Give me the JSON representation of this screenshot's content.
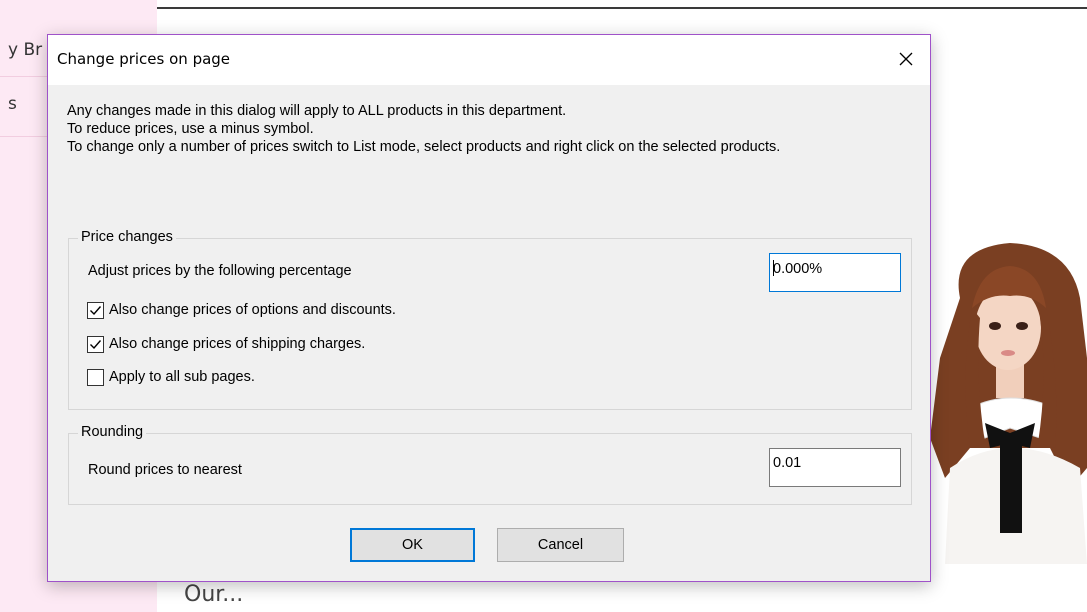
{
  "background": {
    "sidebar_items": [
      "y Br",
      "s"
    ],
    "footer_text": "Our..."
  },
  "dialog": {
    "title": "Change prices on page",
    "close_icon": "close-icon",
    "intro_lines": [
      "Any changes made in this dialog will apply to ALL products in this department.",
      "To reduce prices, use a minus symbol.",
      "To change only a number of prices switch to List mode, select products and right click on the selected products."
    ],
    "price_changes": {
      "legend": "Price changes",
      "adjust_label": "Adjust prices by the following percentage",
      "adjust_value": "0.000%",
      "options_discounts": {
        "label": "Also change prices of options and discounts.",
        "checked": true
      },
      "shipping_charges": {
        "label": "Also change prices of shipping charges.",
        "checked": true
      },
      "sub_pages": {
        "label": "Apply to all sub pages.",
        "checked": false
      }
    },
    "rounding": {
      "legend": "Rounding",
      "round_label": "Round prices to nearest",
      "round_value": "0.01"
    },
    "ok_label": "OK",
    "cancel_label": "Cancel"
  },
  "colors": {
    "dialog_border": "#9f52c9",
    "focus_accent": "#0078d7",
    "sidebar_bg": "#fde9f4"
  }
}
